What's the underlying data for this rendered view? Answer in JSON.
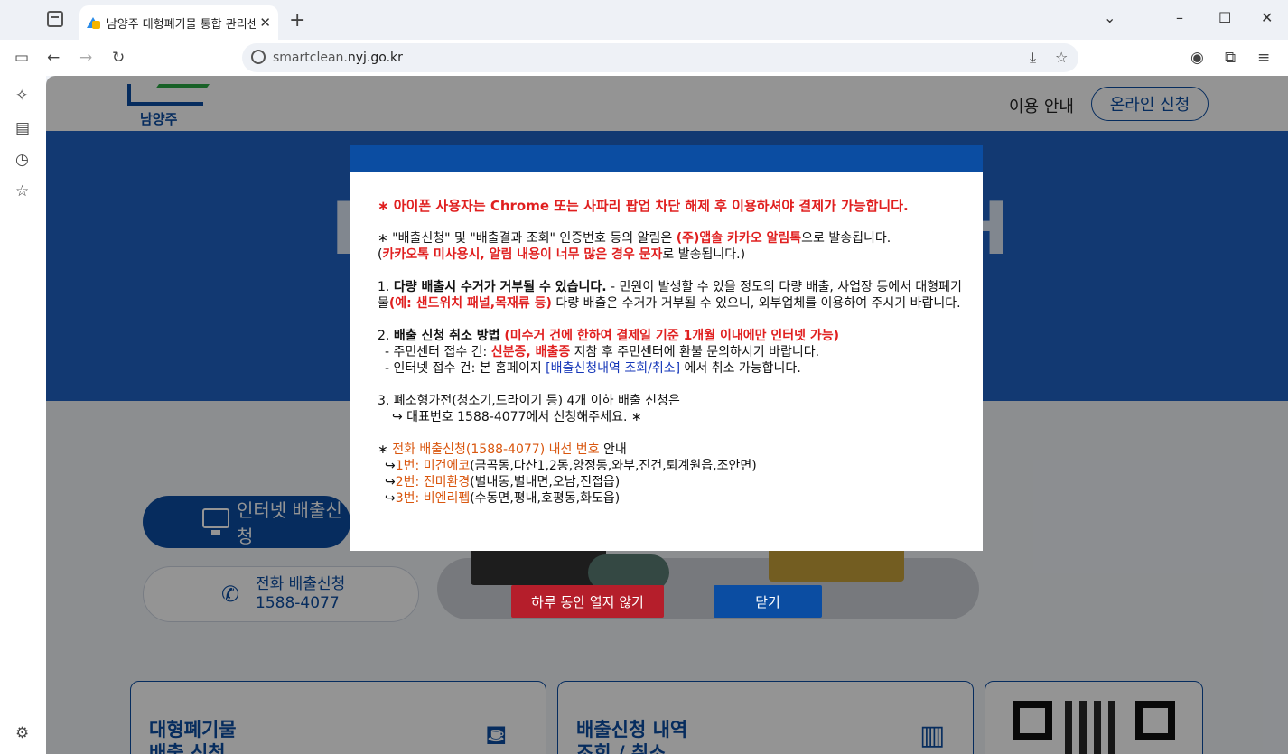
{
  "browser": {
    "tab_title": "남양주 대형폐기물 통합 관리센",
    "tab_close": "✕",
    "new_tab": "+",
    "url_prefix": "smartclean.",
    "url_domain": "nyj.go.kr",
    "min_icon": "–",
    "max_icon": "☐",
    "close_icon": "✕",
    "chevron_icon": "⌄"
  },
  "site": {
    "logo_text": "남양주",
    "nav_guide": "이용 안내",
    "nav_online": "온라인 신청",
    "hero_left": "D",
    "hero_right": "H",
    "main_button": "인터넷 배출신청",
    "phone_label": "전화 배출신청",
    "phone_number": "1588-4077",
    "card1_line1": "대형폐기물",
    "card1_line2": "배출 신청",
    "card2_line1": "배출신청 내역",
    "card2_line2": "조회 / 취소"
  },
  "modal": {
    "iphone_notice": "∗ 아이폰 사용자는 Chrome 또는 사파리 팝업 차단 해제 후 이용하셔야 결제가 가능합니다.",
    "alim_a": "∗ \"배출신청\" 및 \"배출결과 조회\" 인증번호 등의 알림은 ",
    "alim_b": "(주)앱솔 카카오 알림톡",
    "alim_c": "으로 발송됩니다.",
    "alim2_a": "(",
    "alim2_b": "카카오톡 미사용시, 알림 내용이 너무 많은 경우 문자",
    "alim2_c": "로 발송됩니다.)",
    "item1_num": "1. ",
    "item1_title": "다량 배출시 수거가 거부될 수 있습니다.",
    "item1_a": "   - 민원이 발생할 수 있을 정도의 다량 배출, 사업장 등에서 대형폐기물",
    "item1_b": "(예: 샌드위치 패널,목재류 등)",
    "item1_c": " 다량 배출은 수거가 거부될 수 있으니, 외부업체를 이용하여 주시기 바랍니다.",
    "item2_num": "2. ",
    "item2_title": "배출 신청 취소 방법 ",
    "item2_red": "(미수거 건에 한하여 결제일 기준 1개월 이내에만 인터넷 가능)",
    "item2_l1_a": "- 주민센터 접수 건: ",
    "item2_l1_b": "신분증, 배출증",
    "item2_l1_c": " 지참 후 주민센터에 환불 문의하시기 바랍니다.",
    "item2_l2_a": "- 인터넷 접수 건: 본 홈페이지 ",
    "item2_l2_b": "[배출신청내역 조회/취소]",
    "item2_l2_c": " 에서 취소 가능합니다.",
    "item3_l1": "3. 폐소형가전(청소기,드라이기 등) 4개 이하 배출 신청은",
    "item3_l2": "↪ 대표번호 1588-4077에서 신청해주세요. ∗",
    "phone_a": "∗ ",
    "phone_b": "전화 배출신청(1588-4077) 내선 번호",
    "phone_c": " 안내",
    "ext1_a": "↪",
    "ext1_b": "1번: 미건에코",
    "ext1_c": "(금곡동,다산1,2동,양정동,와부,진건,퇴계원읍,조안면)",
    "ext2_a": "↪",
    "ext2_b": "2번: 진미환경",
    "ext2_c": "(별내동,별내면,오남,진접읍)",
    "ext3_a": "↪",
    "ext3_b": "3번: 비엔리펩",
    "ext3_c": "(수동면,평내,호평동,화도읍)",
    "btn_noshow": "하루 동안 열지 않기",
    "btn_close": "닫기"
  },
  "colors": {
    "primary": "#0b4da2",
    "alert_red": "#e01f1f",
    "noshow_button": "#b51e2b",
    "orange": "#d9560e"
  }
}
